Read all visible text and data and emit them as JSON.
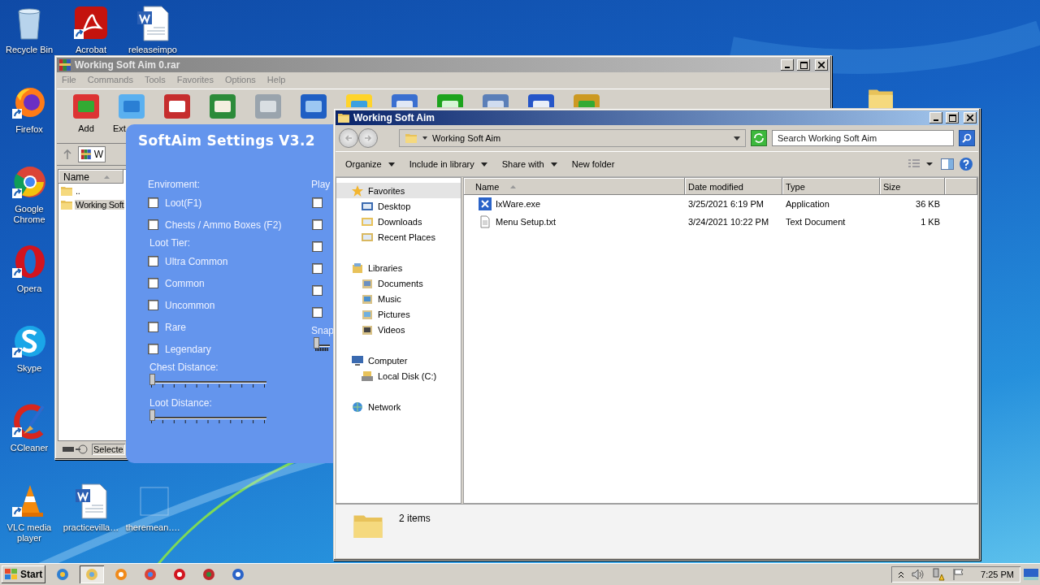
{
  "desktop_icons": [
    {
      "label": "Recycle Bin"
    },
    {
      "label": "Acrobat"
    },
    {
      "label": "releaseimpo"
    },
    {
      "label": "Firefox"
    },
    {
      "label": "Google Chrome"
    },
    {
      "label": "Opera"
    },
    {
      "label": "Skype"
    },
    {
      "label": "CCleaner"
    },
    {
      "label": "VLC media player"
    },
    {
      "label": "practicevilla…"
    },
    {
      "label": "theremean…."
    }
  ],
  "archive_window": {
    "title": "Working Soft Aim 0.rar",
    "menu": [
      "File",
      "Commands",
      "Tools",
      "Favorites",
      "Options",
      "Help"
    ],
    "tools": [
      "Add",
      "Ext"
    ],
    "path": "W",
    "column": "Name",
    "files": [
      {
        "name": "..",
        "selected": false
      },
      {
        "name": "Working Soft",
        "selected": true
      }
    ],
    "status": "Selecte"
  },
  "softaim": {
    "title": "SoftAim Settings V3.2",
    "left": [
      {
        "kind": "heading",
        "text": "Enviroment:"
      },
      {
        "kind": "check",
        "text": "Loot(F1)",
        "checked": false
      },
      {
        "kind": "check",
        "text": "Chests / Ammo Boxes (F2)",
        "checked": false
      },
      {
        "kind": "heading",
        "text": "Loot Tier:"
      },
      {
        "kind": "check",
        "text": "Ultra Common",
        "checked": false
      },
      {
        "kind": "check",
        "text": "Common",
        "checked": false
      },
      {
        "kind": "check",
        "text": "Uncommon",
        "checked": false
      },
      {
        "kind": "check",
        "text": "Rare",
        "checked": false
      },
      {
        "kind": "check",
        "text": "Legendary",
        "checked": false
      },
      {
        "kind": "heading",
        "text": "Chest Distance:"
      },
      {
        "kind": "slider",
        "level": 0
      },
      {
        "kind": "heading",
        "text": "Loot Distance:"
      },
      {
        "kind": "slider",
        "level": 0
      }
    ],
    "right": [
      {
        "kind": "heading",
        "text": "Play"
      },
      {
        "kind": "check",
        "checked": false
      },
      {
        "kind": "check",
        "checked": false
      },
      {
        "kind": "check",
        "checked": false
      },
      {
        "kind": "check",
        "checked": false
      },
      {
        "kind": "check",
        "checked": false
      },
      {
        "kind": "check",
        "checked": false
      },
      {
        "kind": "heading",
        "text": "Snap"
      },
      {
        "kind": "slider",
        "level": 0
      }
    ]
  },
  "explorer": {
    "title": "Working Soft Aim",
    "address": "Working Soft Aim",
    "search": {
      "placeholder": "Search Working Soft Aim"
    },
    "commands": [
      {
        "label": "Organize",
        "menu": true
      },
      {
        "label": "Include in library",
        "menu": true
      },
      {
        "label": "Share with",
        "menu": true
      },
      {
        "label": "New folder",
        "menu": false
      }
    ],
    "nav": [
      {
        "label": "Favorites",
        "selected": true,
        "children": [
          {
            "label": "Desktop",
            "selected": false
          },
          {
            "label": "Downloads",
            "selected": false
          },
          {
            "label": "Recent Places",
            "selected": false
          }
        ]
      },
      {
        "label": "Libraries",
        "selected": false,
        "children": [
          {
            "label": "Documents",
            "selected": false
          },
          {
            "label": "Music",
            "selected": false
          },
          {
            "label": "Pictures",
            "selected": false
          },
          {
            "label": "Videos",
            "selected": false
          }
        ]
      },
      {
        "label": "Computer",
        "selected": false,
        "children": [
          {
            "label": "Local Disk (C:)",
            "selected": false
          }
        ]
      },
      {
        "label": "Network",
        "selected": false
      }
    ],
    "columns": [
      {
        "label": "Name",
        "sorted": true
      },
      {
        "label": "Date modified",
        "sorted": false
      },
      {
        "label": "Type",
        "sorted": false
      },
      {
        "label": "Size",
        "sorted": false
      }
    ],
    "files": [
      {
        "kind": "app",
        "name": "IxWare.exe",
        "date": "3/25/2021 6:19 PM",
        "type": "Application",
        "size": "36 KB"
      },
      {
        "kind": "text",
        "name": "Menu Setup.txt",
        "date": "3/24/2021 10:22 PM",
        "type": "Text Document",
        "size": "1 KB"
      }
    ],
    "status": "2 items"
  },
  "taskbar": {
    "start": "Start",
    "apps": [
      {
        "selected": false
      },
      {
        "selected": true
      },
      {
        "selected": false
      },
      {
        "selected": false
      },
      {
        "selected": false
      },
      {
        "selected": false
      },
      {
        "selected": false
      }
    ],
    "clock": "7:25 PM"
  }
}
